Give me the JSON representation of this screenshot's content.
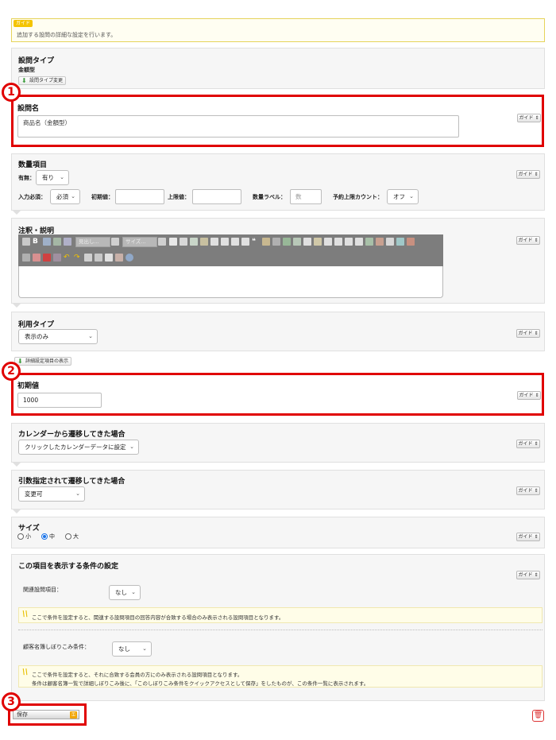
{
  "guide": {
    "badge": "ガイド",
    "text": "追加する設問の詳細な設定を行います。"
  },
  "guide_button_label": "ガイド ⇕",
  "question_type": {
    "title": "設問タイプ",
    "value": "金額型",
    "change_button": "設問タイプ変更"
  },
  "question_name": {
    "title": "設問名",
    "value": "商品名（金額型）"
  },
  "quantity": {
    "title": "数量項目",
    "presence_label": "有無：",
    "presence_value": "有り",
    "required_label": "入力必須：",
    "required_value": "必須",
    "initial_label": "初期値：",
    "max_label": "上限値：",
    "qty_label_label": "数量ラベル：",
    "qty_label_placeholder": "数",
    "reserve_label": "予約上限カウント：",
    "reserve_value": "オフ"
  },
  "notes": {
    "title": "注釈・説明",
    "toolbar_format": "見出し...",
    "toolbar_size": "サイズ..."
  },
  "usage_type": {
    "title": "利用タイプ",
    "value": "表示のみ",
    "detail_button": "詳細設定項目の表示"
  },
  "initial_value": {
    "title": "初期値",
    "value": "1000"
  },
  "calendar": {
    "title": "カレンダーから遷移してきた場合",
    "value": "クリックしたカレンダーデータに設定"
  },
  "argument": {
    "title": "引数指定されて遷移してきた場合",
    "value": "変更可"
  },
  "size": {
    "title": "サイズ",
    "options": [
      "小",
      "中",
      "大"
    ],
    "selected": "中"
  },
  "display_condition": {
    "title": "この項目を表示する条件の設定",
    "related_label": "関連設問項目：",
    "related_value": "なし",
    "note1": "ここで条件を設定すると、関連する設問項目の回答内容が合致する場合のみ表示される設問項目となります。",
    "customer_label": "顧客名簿しぼりこみ条件：",
    "customer_value": "なし",
    "note2_line1": "ここで条件を設定すると、それに合致する会員の方にのみ表示される設問項目となります。",
    "note2_line2": "条件は顧客名簿一覧で詳細しぼりこみ後に、「このしぼりこみ条件をクイックアクセスとして保存」をしたものが、この条件一覧に表示されます。"
  },
  "save_button": "保存",
  "markers": [
    "1",
    "2",
    "3"
  ],
  "colors": {
    "accent_red": "#e00000",
    "guide_yellow": "#f4c400",
    "radio_blue": "#1a73e8"
  }
}
